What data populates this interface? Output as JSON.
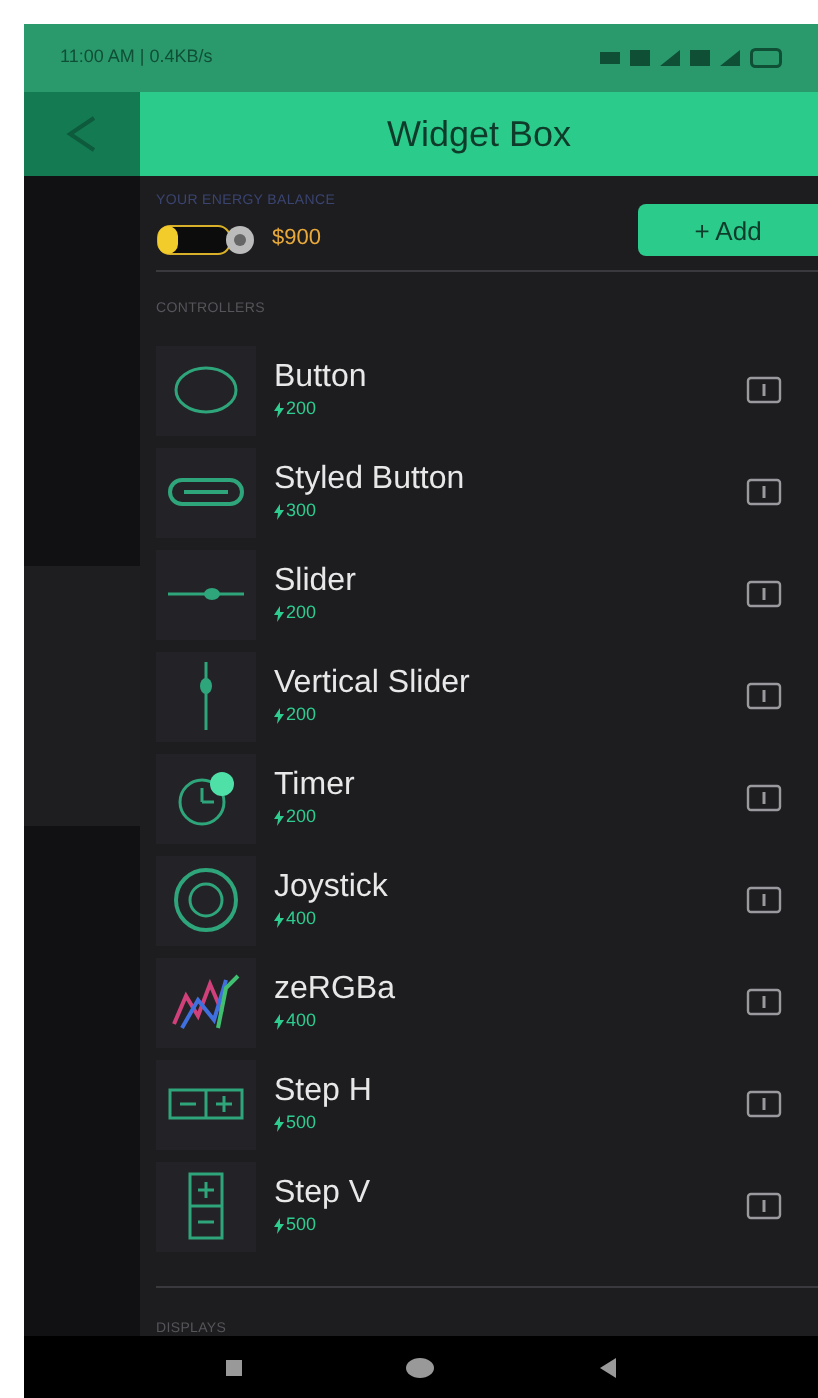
{
  "status_bar": {
    "time": "11:00 AM | 0.4KB/s"
  },
  "header": {
    "title": "Widget Box"
  },
  "balance": {
    "label": "YOUR ENERGY BALANCE",
    "amount": "$900",
    "add_button": "+ Add"
  },
  "sections": [
    {
      "title": "CONTROLLERS",
      "items": [
        {
          "name": "Button",
          "cost": "200",
          "kind": "button"
        },
        {
          "name": "Styled Button",
          "cost": "300",
          "kind": "styled"
        },
        {
          "name": "Slider",
          "cost": "200",
          "kind": "slider"
        },
        {
          "name": "Vertical Slider",
          "cost": "200",
          "kind": "vslider"
        },
        {
          "name": "Timer",
          "cost": "200",
          "kind": "timer"
        },
        {
          "name": "Joystick",
          "cost": "400",
          "kind": "joystick"
        },
        {
          "name": "zeRGBa",
          "cost": "400",
          "kind": "zergba"
        },
        {
          "name": "Step H",
          "cost": "500",
          "kind": "steph"
        },
        {
          "name": "Step V",
          "cost": "500",
          "kind": "stepv"
        }
      ]
    },
    {
      "title": "DISPLAYS"
    }
  ]
}
